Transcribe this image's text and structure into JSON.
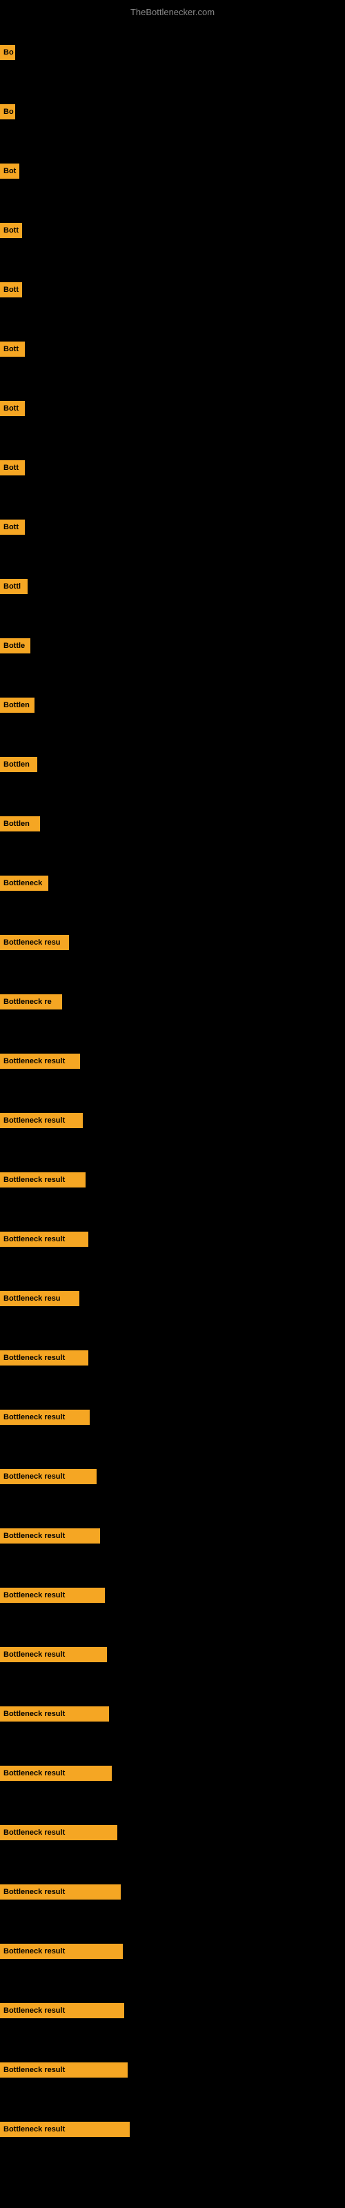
{
  "site": {
    "title": "TheBottlenecker.com"
  },
  "bars": [
    {
      "label": "Bo",
      "width": 22
    },
    {
      "label": "Bo",
      "width": 22
    },
    {
      "label": "Bot",
      "width": 28
    },
    {
      "label": "Bott",
      "width": 32
    },
    {
      "label": "Bott",
      "width": 32
    },
    {
      "label": "Bott",
      "width": 36
    },
    {
      "label": "Bott",
      "width": 36
    },
    {
      "label": "Bott",
      "width": 36
    },
    {
      "label": "Bott",
      "width": 36
    },
    {
      "label": "Bottl",
      "width": 40
    },
    {
      "label": "Bottle",
      "width": 44
    },
    {
      "label": "Bottlen",
      "width": 50
    },
    {
      "label": "Bottlen",
      "width": 54
    },
    {
      "label": "Bottlen",
      "width": 58
    },
    {
      "label": "Bottleneck",
      "width": 70
    },
    {
      "label": "Bottleneck resu",
      "width": 100
    },
    {
      "label": "Bottleneck re",
      "width": 90
    },
    {
      "label": "Bottleneck result",
      "width": 116
    },
    {
      "label": "Bottleneck result",
      "width": 120
    },
    {
      "label": "Bottleneck result",
      "width": 124
    },
    {
      "label": "Bottleneck result",
      "width": 128
    },
    {
      "label": "Bottleneck resu",
      "width": 115
    },
    {
      "label": "Bottleneck result",
      "width": 128
    },
    {
      "label": "Bottleneck result",
      "width": 130
    },
    {
      "label": "Bottleneck result",
      "width": 140
    },
    {
      "label": "Bottleneck result",
      "width": 145
    },
    {
      "label": "Bottleneck result",
      "width": 152
    },
    {
      "label": "Bottleneck result",
      "width": 155
    },
    {
      "label": "Bottleneck result",
      "width": 158
    },
    {
      "label": "Bottleneck result",
      "width": 162
    },
    {
      "label": "Bottleneck result",
      "width": 170
    },
    {
      "label": "Bottleneck result",
      "width": 175
    },
    {
      "label": "Bottleneck result",
      "width": 178
    },
    {
      "label": "Bottleneck result",
      "width": 180
    },
    {
      "label": "Bottleneck result",
      "width": 185
    },
    {
      "label": "Bottleneck result",
      "width": 188
    }
  ]
}
